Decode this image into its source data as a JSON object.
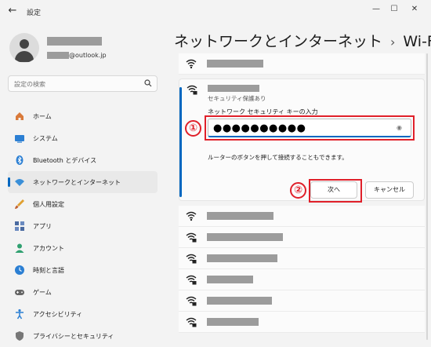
{
  "window": {
    "title": "設定",
    "back_glyph": "←",
    "minimize_glyph": "—",
    "maximize_glyph": "☐",
    "close_glyph": "✕"
  },
  "account": {
    "email_suffix": "@outlook.jp"
  },
  "search": {
    "placeholder": "設定の検索"
  },
  "nav": {
    "items": [
      {
        "label": "ホーム",
        "icon": "home-icon",
        "color": "#d97a3a"
      },
      {
        "label": "システム",
        "icon": "system-icon",
        "color": "#2b7fd3"
      },
      {
        "label": "Bluetooth とデバイス",
        "icon": "bluetooth-icon",
        "color": "#2b7fd3"
      },
      {
        "label": "ネットワークとインターネット",
        "icon": "network-icon",
        "color": "#3a8fd8",
        "selected": true
      },
      {
        "label": "個人用設定",
        "icon": "brush-icon",
        "color": "#e0a030"
      },
      {
        "label": "アプリ",
        "icon": "apps-icon",
        "color": "#4a6aa0"
      },
      {
        "label": "アカウント",
        "icon": "account-icon",
        "color": "#2fa070"
      },
      {
        "label": "時刻と言語",
        "icon": "clock-icon",
        "color": "#2b7fd3"
      },
      {
        "label": "ゲーム",
        "icon": "game-icon",
        "color": "#666666"
      },
      {
        "label": "アクセシビリティ",
        "icon": "accessibility-icon",
        "color": "#2b7fd3"
      },
      {
        "label": "プライバシーとセキュリティ",
        "icon": "shield-icon",
        "color": "#777777"
      }
    ]
  },
  "header": {
    "section": "ネットワークとインターネット",
    "separator": "›",
    "page": "Wi-Fi"
  },
  "wifi": {
    "expanded": {
      "security": "セキュリティ保護あり",
      "key_label": "ネットワーク セキュリティ キーの入力",
      "password_value": "●●●●●●●●●●",
      "hint": "ルーターのボタンを押して接続することもできます。",
      "next_label": "次へ",
      "cancel_label": "キャンセル"
    }
  },
  "annotations": {
    "marker1": "①",
    "marker2": "②",
    "color": "#e0202a"
  },
  "theme": {
    "accent": "#0067c0"
  }
}
